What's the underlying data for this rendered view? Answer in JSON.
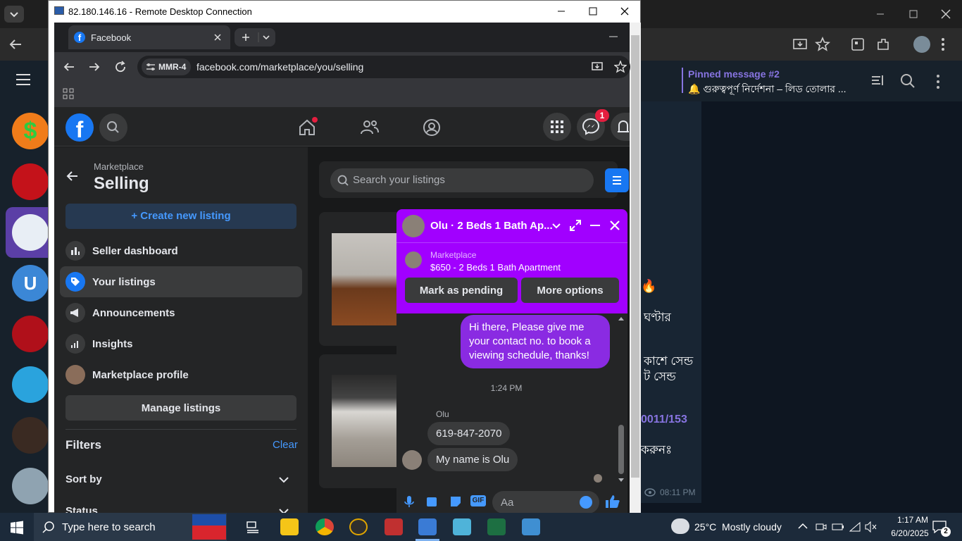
{
  "remote_window": {
    "title": "82.180.146.16 - Remote Desktop Connection"
  },
  "browser": {
    "tab_title": "Facebook",
    "profile_chip": "MMR-4",
    "url": "facebook.com/marketplace/you/selling"
  },
  "facebook": {
    "badge_messenger": "1",
    "sidebar": {
      "section": "Marketplace",
      "title": "Selling",
      "create_label": "+ Create new listing",
      "items": [
        {
          "label": "Seller dashboard"
        },
        {
          "label": "Your listings"
        },
        {
          "label": "Announcements"
        },
        {
          "label": "Insights"
        },
        {
          "label": "Marketplace profile"
        }
      ],
      "manage_label": "Manage listings",
      "filters_label": "Filters",
      "clear_label": "Clear",
      "sort_label": "Sort by",
      "status_label": "Status"
    },
    "search": {
      "placeholder": "Search your listings"
    }
  },
  "chat": {
    "title": "Olu · 2 Beds 1 Bath Ap...",
    "context_label": "Marketplace",
    "listing": "$650 - 2 Beds 1 Bath Apartment",
    "pending_label": "Mark as pending",
    "more_label": "More options",
    "outgoing_message": "Hi there, Please give me your contact no. to book a viewing schedule, thanks!",
    "time": "1:24 PM",
    "sender": "Olu",
    "incoming": [
      "619-847-2070",
      "My name is Olu"
    ],
    "composer_placeholder": "Aa"
  },
  "telegram": {
    "pinned_title": "Pinned message #2",
    "pinned_text": "🔔 গুরুত্বপূর্ণ নির্দেশনা – লিড তোলার ...",
    "fragments": [
      "ঘণ্টার",
      "কাশে সেন্ড",
      "ট সেন্ড",
      "0011/153",
      "করুনঃ"
    ],
    "msg_time": "08:11 PM"
  },
  "taskbar": {
    "search_placeholder": "Type here to search",
    "weather": "25°C  Mostly cloudy",
    "time": "1:17 AM",
    "date": "6/20/2025",
    "notifications": "2"
  },
  "colors": {
    "accent_purple": "#a100ff",
    "fb_blue": "#1877f2",
    "fb_bg": "#18191a"
  }
}
